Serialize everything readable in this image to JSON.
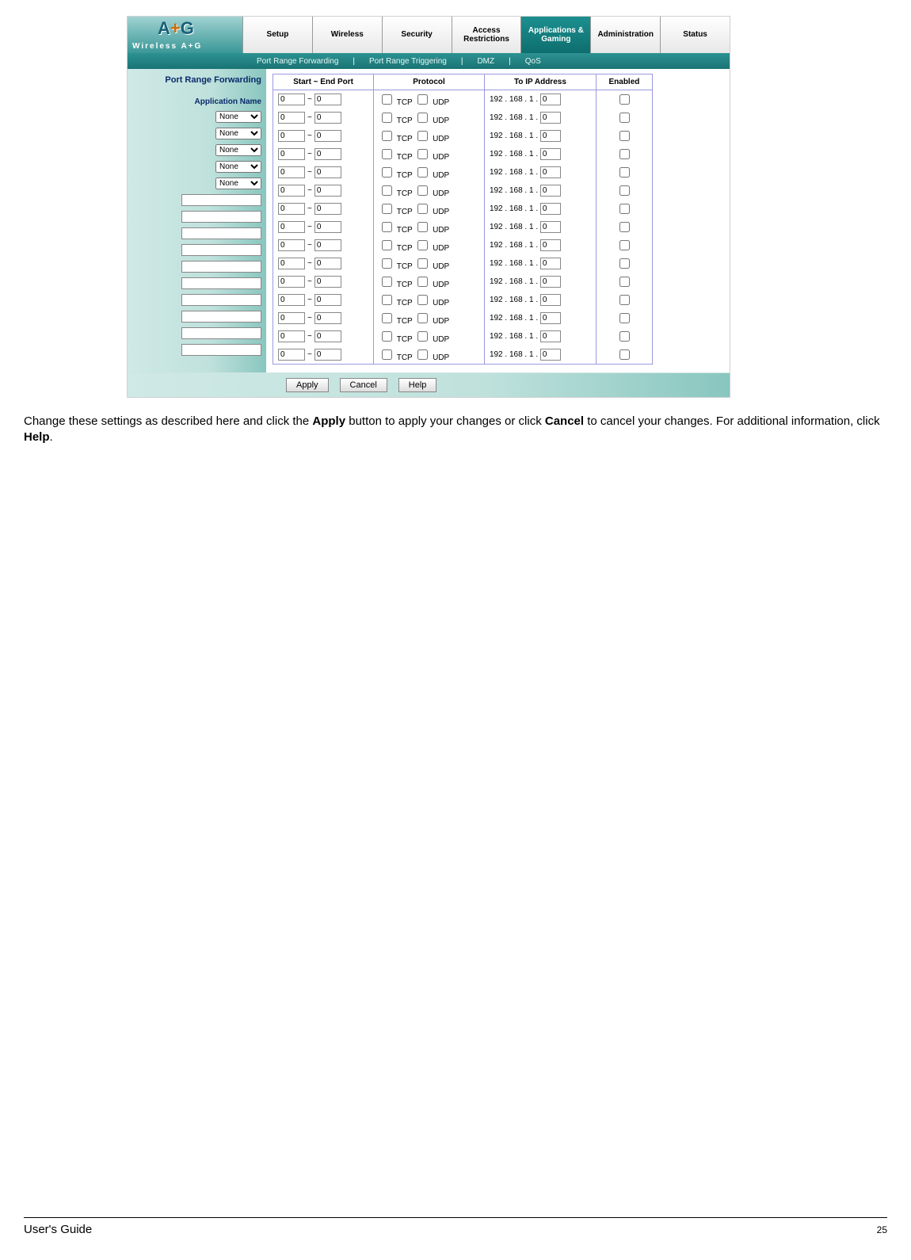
{
  "header": {
    "logo_top": "A+G",
    "logo_sub": "Wireless A+G",
    "tabs": [
      "Setup",
      "Wireless",
      "Security",
      "Access\nRestrictions",
      "Applications &\nGaming",
      "Administration",
      "Status"
    ],
    "active_tab_index": 4,
    "subtabs": [
      "Port Range Forwarding",
      "Port Range Triggering",
      "DMZ",
      "QoS"
    ]
  },
  "sidebar": {
    "title": "Port Range Forwarding",
    "app_name_label": "Application Name",
    "select_default": "None",
    "select_rows": 5,
    "text_rows": 10
  },
  "table": {
    "headers": [
      "Start ~ End Port",
      "Protocol",
      "To IP Address",
      "Enabled"
    ],
    "port_value": "0",
    "tilde": "~",
    "tcp_label": "TCP",
    "udp_label": "UDP",
    "ip_prefix": "192 . 168 . 1 .",
    "ip_octet": "0",
    "rows": 15
  },
  "buttons": {
    "apply": "Apply",
    "cancel": "Cancel",
    "help": "Help"
  },
  "caption": {
    "t1": "Change these settings as described here and click the ",
    "b1": "Apply",
    "t2": " button to apply your changes or click ",
    "b2": "Cancel",
    "t3": " to cancel your changes. For additional information, click ",
    "b3": "Help",
    "t4": "."
  },
  "footer": {
    "guide": "User's Guide",
    "page": "25"
  }
}
